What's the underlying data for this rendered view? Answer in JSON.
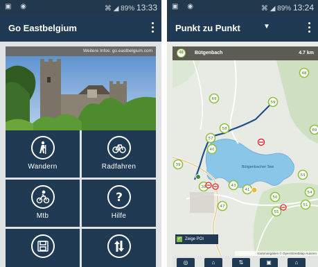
{
  "left_phone": {
    "status": {
      "left_icons": "▣ ◉",
      "right_icons": "⌘ ◢ 89%",
      "time": "13:33"
    },
    "appbar": {
      "title": "Go Eastbelgium"
    },
    "info_banner": "Weitere Infos: go.eastbelgium.com",
    "tiles": [
      {
        "label": "Wandern",
        "icon": "hiker-icon"
      },
      {
        "label": "Radfahren",
        "icon": "bicycle-icon"
      },
      {
        "label": "Mtb",
        "icon": "mountain-bike-icon"
      },
      {
        "label": "Hilfe",
        "icon": "help-icon"
      },
      {
        "label": "",
        "icon": "save-icon"
      },
      {
        "label": "",
        "icon": "sort-arrows-icon"
      }
    ]
  },
  "right_phone": {
    "status": {
      "left_icons": "▣ ◉",
      "right_icons": "⌘ ◢ 89%",
      "time": "13:24"
    },
    "appbar": {
      "title": "Punkt zu Punkt",
      "dropdown_glyph": "▼"
    },
    "route": {
      "start_number": "48",
      "place": "Bütgenbach",
      "distance": "4.7 km"
    },
    "map": {
      "lake_label": "Bütgenbacher See",
      "nodes": [
        "48",
        "59",
        "58",
        "57",
        "40",
        "39",
        "38",
        "50",
        "53",
        "54",
        "55",
        "47",
        "43",
        "41",
        "51",
        "69",
        "69"
      ],
      "poi_toggle_label": "Zeige POI",
      "poi_checked": true,
      "attribution": "Kartenangaben © OpenStreetMap-Autoren"
    },
    "bottom_buttons": [
      {
        "icon": "location-icon"
      },
      {
        "icon": "home-icon"
      },
      {
        "icon": "route-icon"
      },
      {
        "icon": "save-icon"
      },
      {
        "icon": "share-icon"
      }
    ]
  }
}
